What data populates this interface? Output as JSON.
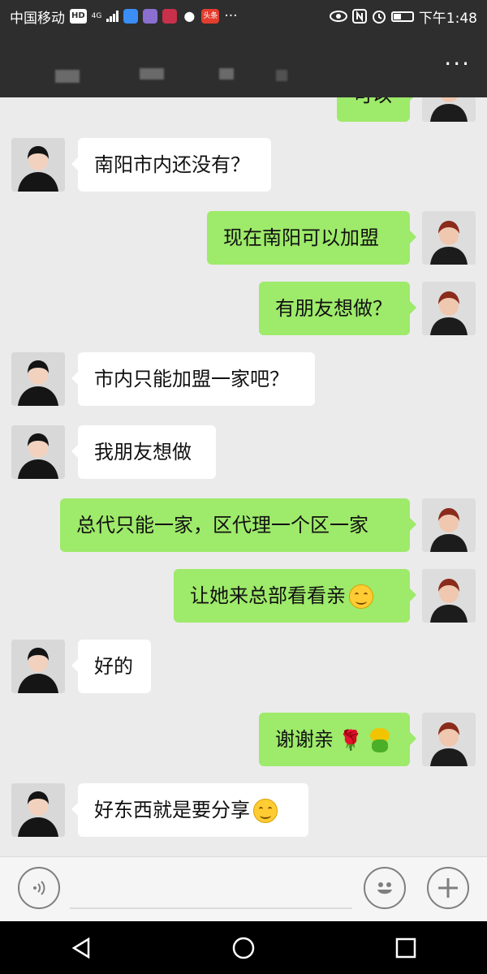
{
  "status_bar": {
    "carrier": "中国移动",
    "hd": "HD",
    "network": "4G",
    "news_badge": "头条",
    "overflow": "···",
    "time": "下午1:48"
  },
  "title_bar": {
    "more_label": "···"
  },
  "messages": [
    {
      "id": "m0",
      "side": "out",
      "text": "可以"
    },
    {
      "id": "m1",
      "side": "in",
      "text": "南阳市内还没有？"
    },
    {
      "id": "m2",
      "side": "out",
      "text": "现在南阳可以加盟"
    },
    {
      "id": "m3",
      "side": "out",
      "text": "有朋友想做？"
    },
    {
      "id": "m4",
      "side": "in",
      "text": "市内只能加盟一家吧？"
    },
    {
      "id": "m5",
      "side": "in",
      "text": "我朋友想做"
    },
    {
      "id": "m6",
      "side": "out",
      "text": "总代只能一家，区代理一个区一家"
    },
    {
      "id": "m7",
      "side": "out",
      "text": "让她来总部看看亲",
      "emoji": "smile-emoji"
    },
    {
      "id": "m8",
      "side": "in",
      "text": "好的"
    },
    {
      "id": "m9",
      "side": "out",
      "text": "谢谢亲",
      "emoji": "rose-emoji, frog-emoji"
    },
    {
      "id": "m10",
      "side": "in",
      "text": "好东西就是要分享",
      "emoji": "smile-emoji"
    }
  ],
  "input_bar": {
    "voice_icon": "voice-icon",
    "emoji_icon": "emoji-face-icon",
    "plus_icon": "plus-icon",
    "value": ""
  },
  "nav_bar": {
    "back_icon": "back-triangle-icon",
    "home_icon": "home-circle-icon",
    "recents_icon": "recents-square-icon"
  },
  "colors": {
    "bubble_out": "#9eea6a",
    "bubble_in": "#ffffff",
    "chat_bg": "#ebebeb",
    "header_bg": "#2e2e2e"
  }
}
